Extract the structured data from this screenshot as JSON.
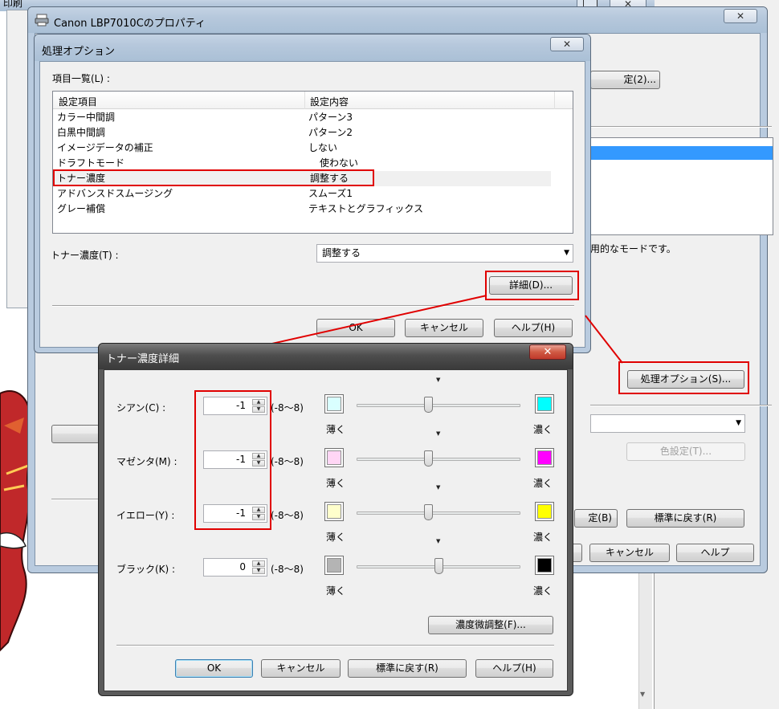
{
  "background_window": {
    "title": "印刷",
    "close_glyph": "✕"
  },
  "props_window": {
    "title": "Canon LBP7010Cのプロパティ",
    "close_glyph": "✕",
    "btn_partial": "定(2)...",
    "desc_fragment": "用的なモードです。",
    "processing_options_button": "処理オプション(S)...",
    "color_settings_button": "色設定(T)...",
    "settings_partial": "定(B)",
    "restore_defaults_button": "標準に戻す(R)",
    "cancel_button": "キャンセル",
    "help_button": "ヘルプ"
  },
  "processing_dialog": {
    "title": "処理オプション",
    "close_glyph": "✕",
    "list_label": "項目一覧(L) :",
    "columns": [
      "設定項目",
      "設定内容"
    ],
    "rows": [
      {
        "item": "カラー中間調",
        "value": "パターン3"
      },
      {
        "item": "白黒中間調",
        "value": "パターン2"
      },
      {
        "item": "イメージデータの補正",
        "value": "しない"
      },
      {
        "item": "ドラフトモード",
        "value": "使わない"
      },
      {
        "item": "トナー濃度",
        "value": "調整する"
      },
      {
        "item": "アドバンスドスムージング",
        "value": "スムーズ1"
      },
      {
        "item": "グレー補償",
        "value": "テキストとグラフィックス"
      }
    ],
    "toner_label": "トナー濃度(T) :",
    "toner_value": "調整する",
    "details_button": "詳細(D)...",
    "ok_button": "OK",
    "cancel_button": "キャンセル",
    "help_button": "ヘルプ(H)"
  },
  "toner_dialog": {
    "title": "トナー濃度詳細",
    "close_glyph": "✕",
    "range_text": "(-8〜8)",
    "light_label": "薄く",
    "dark_label": "濃く",
    "channels": [
      {
        "label": "シアン(C) :",
        "value": "-1",
        "light_color": "#d9ffff",
        "dark_color": "#00ffff",
        "level": -1
      },
      {
        "label": "マゼンタ(M) :",
        "value": "-1",
        "light_color": "#ffd6f5",
        "dark_color": "#ff00ff",
        "level": -1
      },
      {
        "label": "イエロー(Y) :",
        "value": "-1",
        "light_color": "#ffffcc",
        "dark_color": "#ffff00",
        "level": -1
      },
      {
        "label": "ブラック(K) :",
        "value": "0",
        "light_color": "#b4b4b4",
        "dark_color": "#000000",
        "level": 0
      }
    ],
    "fine_adjust_button": "濃度微調整(F)...",
    "ok_button": "OK",
    "cancel_button": "キャンセル",
    "restore_button": "標準に戻す(R)",
    "help_button": "ヘルプ(H)"
  },
  "colors": {
    "highlight_red": "#e00000",
    "selection_blue": "#3399ff"
  }
}
